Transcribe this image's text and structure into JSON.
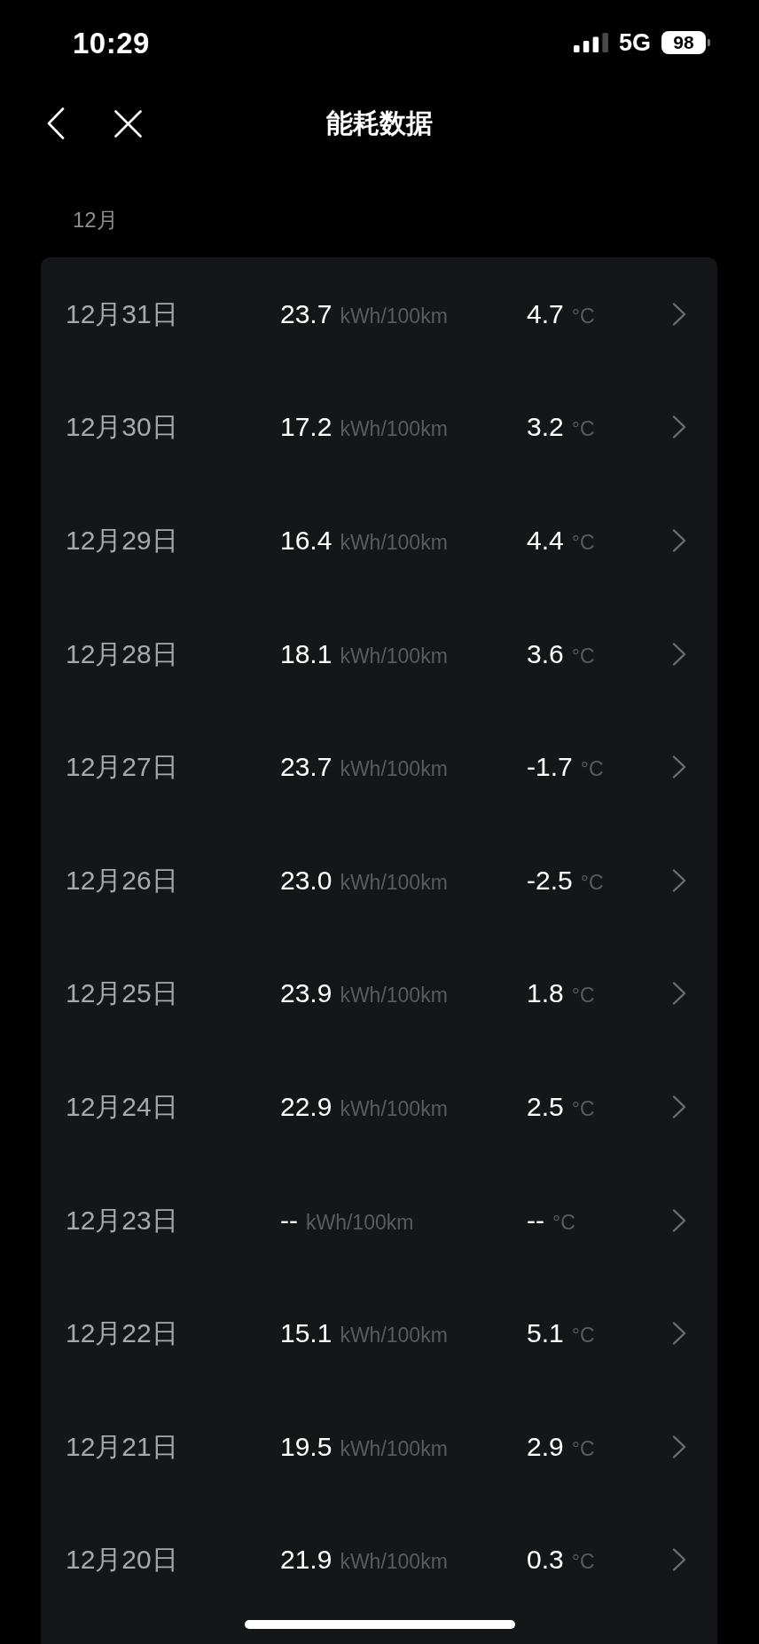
{
  "status_bar": {
    "time": "10:29",
    "network": "5G",
    "battery": "98"
  },
  "header": {
    "title": "能耗数据"
  },
  "month": {
    "label": "12月",
    "rows": [
      {
        "date": "12月31日",
        "consumption": "23.7",
        "consumption_unit": "kWh/100km",
        "temperature": "4.7",
        "temperature_unit": "°C"
      },
      {
        "date": "12月30日",
        "consumption": "17.2",
        "consumption_unit": "kWh/100km",
        "temperature": "3.2",
        "temperature_unit": "°C"
      },
      {
        "date": "12月29日",
        "consumption": "16.4",
        "consumption_unit": "kWh/100km",
        "temperature": "4.4",
        "temperature_unit": "°C"
      },
      {
        "date": "12月28日",
        "consumption": "18.1",
        "consumption_unit": "kWh/100km",
        "temperature": "3.6",
        "temperature_unit": "°C"
      },
      {
        "date": "12月27日",
        "consumption": "23.7",
        "consumption_unit": "kWh/100km",
        "temperature": "-1.7",
        "temperature_unit": "°C"
      },
      {
        "date": "12月26日",
        "consumption": "23.0",
        "consumption_unit": "kWh/100km",
        "temperature": "-2.5",
        "temperature_unit": "°C"
      },
      {
        "date": "12月25日",
        "consumption": "23.9",
        "consumption_unit": "kWh/100km",
        "temperature": "1.8",
        "temperature_unit": "°C"
      },
      {
        "date": "12月24日",
        "consumption": "22.9",
        "consumption_unit": "kWh/100km",
        "temperature": "2.5",
        "temperature_unit": "°C"
      },
      {
        "date": "12月23日",
        "consumption": "--",
        "consumption_unit": "kWh/100km",
        "temperature": "--",
        "temperature_unit": "°C"
      },
      {
        "date": "12月22日",
        "consumption": "15.1",
        "consumption_unit": "kWh/100km",
        "temperature": "5.1",
        "temperature_unit": "°C"
      },
      {
        "date": "12月21日",
        "consumption": "19.5",
        "consumption_unit": "kWh/100km",
        "temperature": "2.9",
        "temperature_unit": "°C"
      },
      {
        "date": "12月20日",
        "consumption": "21.9",
        "consumption_unit": "kWh/100km",
        "temperature": "0.3",
        "temperature_unit": "°C"
      }
    ]
  }
}
